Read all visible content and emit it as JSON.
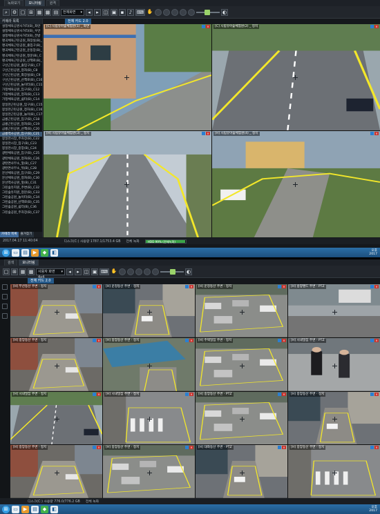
{
  "top_window": {
    "tabs": [
      "녹화보기",
      "모니터링",
      "원격",
      "모니터링"
    ],
    "active_tab": 1,
    "toolbar": {
      "combo": "전체화면",
      "icons": [
        "search-icon",
        "gear-icon",
        "layout-1x1-icon",
        "layout-2x2-icon",
        "layout-3x3-icon",
        "layout-4x4-icon",
        "layout-custom-icon",
        "prev-icon",
        "play-icon",
        "next-icon",
        "capture-icon",
        "print-icon",
        "ptz-icon",
        "hand-icon",
        "record-icon",
        "audio-icon",
        "volume-slider"
      ]
    },
    "sidebar": {
      "header": "카메라 목록",
      "items": [
        "설정체육공원사거리(B)_좌안",
        "설정체육공원사거리(B)_우안",
        "설정체육공원사거리(B)_전방",
        "명곡체육근린공원_화장실(B)_",
        "명곡체육근린공원_출입구(B)_",
        "명곡체육근린공원_운동장(B)_",
        "명곡체육근린공원_정문(B)_C",
        "명곡체육근린공원_산책로(B)_",
        "구산근린공원_출입구(B)_C7",
        "구산근린공원_정자(B)_C8",
        "구산근린공원_화장실(B)_C9",
        "구산근린공원_산책로(B)_C10",
        "구산근린공원_놀이터(B)_C11",
        "가정체육공원_입구(B)_C12",
        "가정체육공원_정자(B)_C13",
        "가정체육공원_쉼터(B)_C14",
        "봉일천근린공원_입구(B)_C15",
        "봉일천근린공원_정자(B)_C16",
        "봉일천근린공원_놀이(B)_C17",
        "금릉근린공원_입구(B)_C18",
        "금릉근린공원_정자(B)_C19",
        "금릉근린공원_산책(B)_C20",
        "금릉역사공원_입구(B)_C21",
        "봉일천시장_주차장(B)_C22",
        "봉일천시장_입구(B)_C23",
        "봉일천시장_중앙(B)_C24",
        "광탄체육공원_입구(B)_C25",
        "광탄체육공원_정자(B)_C26",
        "광탄면사무소_앞(B)_C27",
        "광탄면사무소_뒤(B)_C28",
        "문산체육공원_입구(B)_C29",
        "문산체육공원_정자(B)_C30",
        "문산역사공원_앞(B)_C31",
        "그린숲유치원_주변(B)_C32",
        "그린숲유치원_정문(B)_C33",
        "그린숲공원_놀이터(B)_C34",
        "그린숲공원_산책로(B)_C35",
        "그린숲공원_쉼터(B)_C36",
        "그린숲공원_주차장(B)_C37"
      ],
      "selected_index": 22,
      "bottom_tabs": [
        "카메라 목록",
        "즐겨찾기"
      ],
      "active_bottom_tab": 0
    },
    "group_tab": "전체 카드 2.0",
    "cameras": [
      {
        "label": "[C] 시립유아숲체험원(1) _ 화면",
        "scene": "school"
      },
      {
        "label": "[C] 시립유아숲체험원(2) _ 정지",
        "scene": "road"
      },
      {
        "label": "[H] 시립유아숲체험원(3) _ 정지",
        "scene": "road2"
      },
      {
        "label": "[H] 시립유아숲체험원(4) _ 정지",
        "scene": "park"
      }
    ],
    "status": {
      "datetime": "2017.04.17 11:40:04",
      "disk": "디스크(C:) 사용량 1787.1/1753.4 GB",
      "record": "전체 녹화",
      "progress_text": "HDD 99% (전체녹화)",
      "progress": 0.99
    },
    "clock": [
      "오후",
      "2017"
    ]
  },
  "bottom_window": {
    "tabs": [
      "검색",
      "모니터링"
    ],
    "active_tab": 1,
    "toolbar": {
      "combo": "사용자 화면 4x4"
    },
    "group_tab": "전체 카드 2.0",
    "cameras": [
      {
        "label": "[H] 부산동산 주변 - 정지",
        "scene": "alley"
      },
      {
        "label": "[H] 운정동산 주변 - 정지",
        "scene": "street"
      },
      {
        "label": "[H] 운정동산 주변 - 정지",
        "scene": "parking"
      },
      {
        "label": "[H] 송양랜드 주변 - PTZ",
        "scene": "ptz"
      },
      {
        "label": "[H] 중앙동산 주변 - 정지",
        "scene": "alley"
      },
      {
        "label": "[H] 중앙동산 주변 - 정지",
        "scene": "roofs"
      },
      {
        "label": "[H] 주택밀집 주변 - 정지",
        "scene": "parking"
      },
      {
        "label": "[H] 시내밀집 주변 - PTZ",
        "scene": "walkers"
      },
      {
        "label": "[H] 시내밀집 주변 - 정지",
        "scene": "road"
      },
      {
        "label": "[H] 시내밀집 주변 - 정지",
        "scene": "crosswalk"
      },
      {
        "label": "[H] 중앙동산 주변 - PTZ",
        "scene": "parking"
      },
      {
        "label": "[H] 중앙동산 주변 - 정지",
        "scene": "street"
      },
      {
        "label": "[H] 중앙동산 주변 - 정지",
        "scene": "alley"
      },
      {
        "label": "[H] 중앙동산 주변 - 정지",
        "scene": "parking"
      },
      {
        "label": "[H] 대화동산 주변 - PTZ",
        "scene": "street"
      },
      {
        "label": "[H] 중앙동산 주변 - 정지",
        "scene": "crosswalk"
      }
    ],
    "status": {
      "disk": "디스크(C:) 사용량 776.0/776.2 GB",
      "record": "전체 녹화"
    },
    "clock": [
      "오후",
      "2017"
    ]
  },
  "colors": {
    "accent": "#265a8a",
    "zone": "#f3e72a",
    "close": "#c8322d"
  }
}
